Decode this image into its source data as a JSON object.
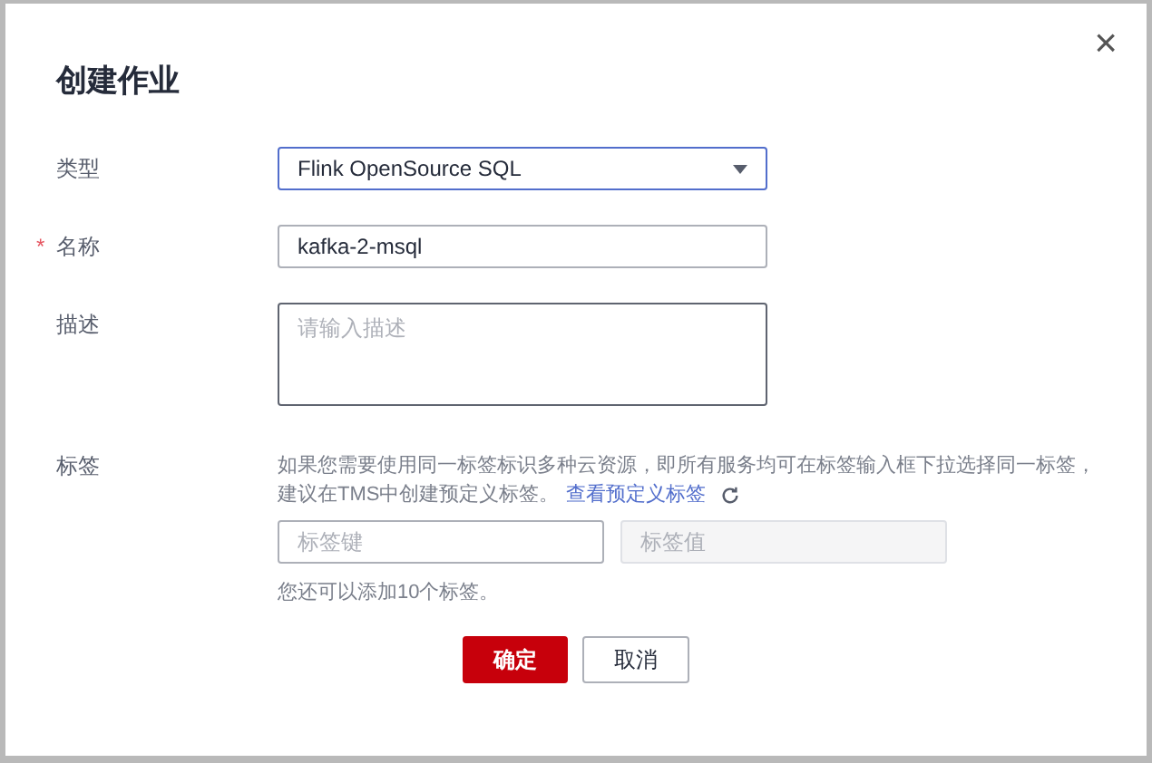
{
  "dialog": {
    "title": "创建作业",
    "close": "×"
  },
  "fields": [
    {
      "kind": "select",
      "label": "类型",
      "value": "Flink OpenSource SQL",
      "focused": true
    },
    {
      "kind": "text",
      "label": "名称",
      "required_mark": "*",
      "value": "kafka-2-msql",
      "focused": false
    },
    {
      "kind": "textarea",
      "label": "描述",
      "placeholder": "请输入描述",
      "focused": false
    }
  ],
  "tags": {
    "label": "标签",
    "hint_lines": [
      "如果您需要使用同一标签标识多种云资源，即所有服务均可在标签输入框下拉选择同一标签，",
      "建议在TMS中创建预定义标签。"
    ],
    "link": "查看预定义标签",
    "key_placeholder": "标签键",
    "value_placeholder": "标签值",
    "value_disabled": true,
    "remaining": "您还可以添加10个标签。"
  },
  "buttons": [
    {
      "label": "确定",
      "primary": true
    },
    {
      "label": "取消",
      "primary": false
    }
  ]
}
